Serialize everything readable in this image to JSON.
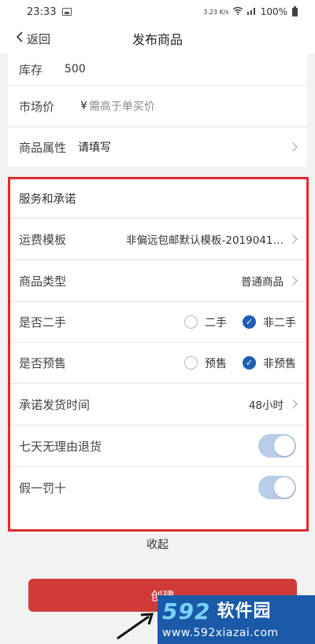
{
  "status_bar": {
    "time": "23:33",
    "network": "3.23 K/s",
    "battery": "100%"
  },
  "nav": {
    "back_label": "返回",
    "title": "发布商品"
  },
  "stock": {
    "label": "库存",
    "value": "500"
  },
  "market_price": {
    "label": "市场价",
    "currency": "¥",
    "placeholder": "需高于单买价"
  },
  "attributes": {
    "label": "商品属性",
    "value": "请填写"
  },
  "service": {
    "title": "服务和承诺",
    "shipping_template": {
      "label": "运费模板",
      "value": "非偏远包邮默认模板-2019041…"
    },
    "product_type": {
      "label": "商品类型",
      "value": "普通商品"
    },
    "second_hand": {
      "label": "是否二手",
      "option_yes": "二手",
      "option_no": "非二手",
      "selected": "非二手"
    },
    "presale": {
      "label": "是否预售",
      "option_yes": "预售",
      "option_no": "非预售",
      "selected": "非预售"
    },
    "ship_time": {
      "label": "承诺发货时间",
      "value": "48小时"
    },
    "seven_day_return": {
      "label": "七天无理由退货",
      "enabled": true
    },
    "fake_penalty": {
      "label": "假一罚十",
      "enabled": true
    }
  },
  "collapse_label": "收起",
  "create_label": "创建",
  "watermark": {
    "brand_num": "592",
    "brand_cn": "软件园",
    "url": "www.592xiazai.com"
  },
  "colors": {
    "accent": "#1e5fb4",
    "create_button": "#d03b37",
    "highlight_border": "#e02a2a",
    "toggle_on": "#b8cde8"
  }
}
